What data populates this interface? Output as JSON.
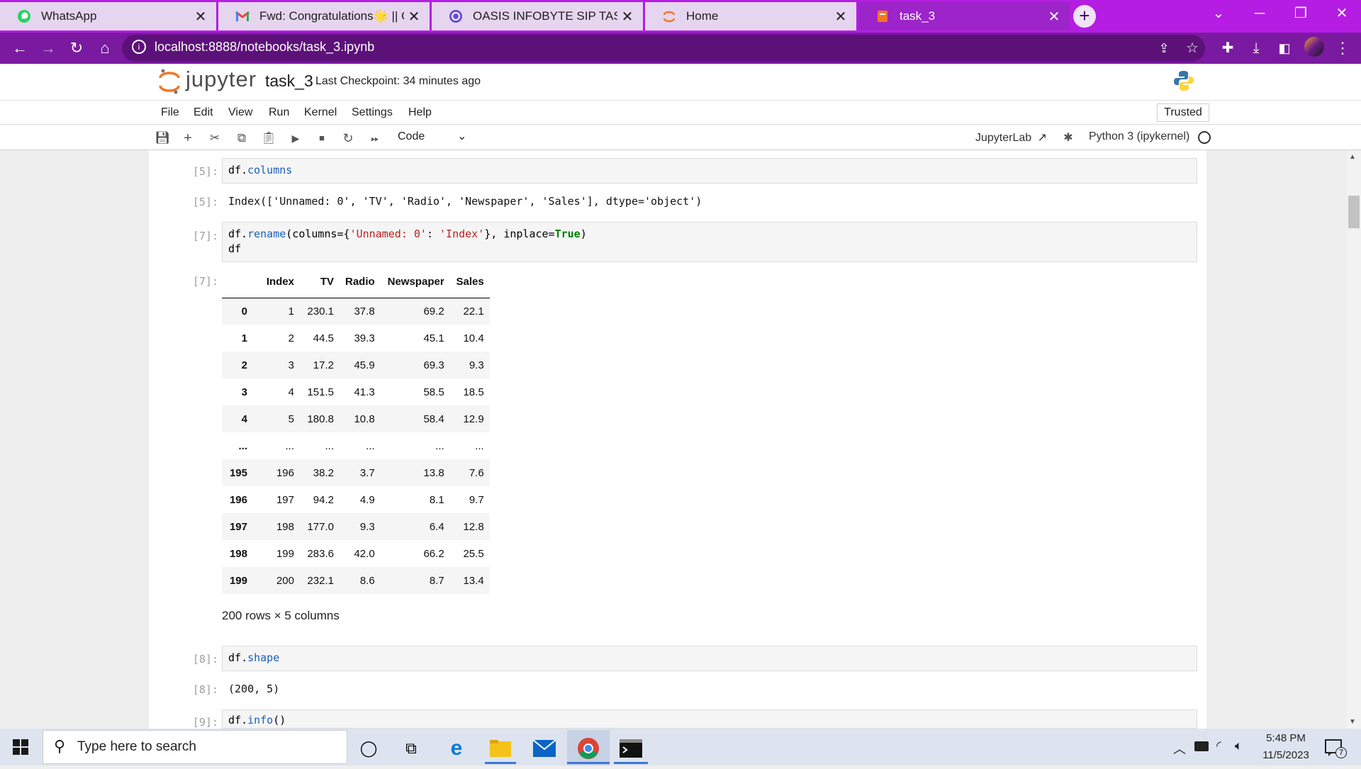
{
  "browser": {
    "tabs": [
      {
        "title": "WhatsApp",
        "icon": "whatsapp-icon",
        "active": false
      },
      {
        "title": "Fwd: Congratulations🌟 || Offer",
        "icon": "gmail-icon",
        "active": false
      },
      {
        "title": "OASIS INFOBYTE SIP TASK LIST",
        "icon": "chatgpt-icon",
        "active": false
      },
      {
        "title": "Home",
        "icon": "jupyter-icon",
        "active": false
      },
      {
        "title": "task_3",
        "icon": "jupyter-notebook-icon",
        "active": true
      }
    ],
    "url": "localhost:8888/notebooks/task_3.ipynb",
    "accent_color": "#b51de3"
  },
  "jupyter": {
    "logo_text": "jupyter",
    "notebook_name": "task_3",
    "checkpoint": "Last Checkpoint: 34 minutes ago",
    "menu": [
      "File",
      "Edit",
      "View",
      "Run",
      "Kernel",
      "Settings",
      "Help"
    ],
    "trusted": "Trusted",
    "cell_type": "Code",
    "jupyterlab_link": "JupyterLab",
    "kernel": "Python 3 (ipykernel)"
  },
  "cells": {
    "c5": {
      "in_prompt": "[5]:",
      "obj": "df",
      "attr": "columns",
      "out_prompt": "[5]:",
      "output": "Index(['Unnamed: 0', 'TV', 'Radio', 'Newspaper', 'Sales'], dtype='object')"
    },
    "c7": {
      "in_prompt": "[7]:",
      "line1_obj": "df.",
      "line1_func": "rename",
      "line1_a": "(columns={",
      "line1_s1": "'Unnamed: 0'",
      "line1_b": ": ",
      "line1_s2": "'Index'",
      "line1_c": "}, inplace=",
      "line1_true": "True",
      "line1_d": ")",
      "line2": "df",
      "out_prompt": "[7]:",
      "summary": "200 rows × 5 columns"
    },
    "c8": {
      "in_prompt": "[8]:",
      "obj": "df",
      "attr": "shape",
      "out_prompt": "[8]:",
      "output": "(200, 5)"
    },
    "c9": {
      "in_prompt": "[9]:",
      "obj": "df",
      "attr": "info",
      "paren": "()"
    }
  },
  "dataframe": {
    "columns": [
      "Index",
      "TV",
      "Radio",
      "Newspaper",
      "Sales"
    ],
    "rows": [
      [
        "0",
        "1",
        "230.1",
        "37.8",
        "69.2",
        "22.1"
      ],
      [
        "1",
        "2",
        "44.5",
        "39.3",
        "45.1",
        "10.4"
      ],
      [
        "2",
        "3",
        "17.2",
        "45.9",
        "69.3",
        "9.3"
      ],
      [
        "3",
        "4",
        "151.5",
        "41.3",
        "58.5",
        "18.5"
      ],
      [
        "4",
        "5",
        "180.8",
        "10.8",
        "58.4",
        "12.9"
      ],
      [
        "...",
        "...",
        "...",
        "...",
        "...",
        "..."
      ],
      [
        "195",
        "196",
        "38.2",
        "3.7",
        "13.8",
        "7.6"
      ],
      [
        "196",
        "197",
        "94.2",
        "4.9",
        "8.1",
        "9.7"
      ],
      [
        "197",
        "198",
        "177.0",
        "9.3",
        "6.4",
        "12.8"
      ],
      [
        "198",
        "199",
        "283.6",
        "42.0",
        "66.2",
        "25.5"
      ],
      [
        "199",
        "200",
        "232.1",
        "8.6",
        "8.7",
        "13.4"
      ]
    ]
  },
  "taskbar": {
    "search_placeholder": "Type here to search",
    "time": "5:48 PM",
    "date": "11/5/2023",
    "notification_count": "7"
  }
}
